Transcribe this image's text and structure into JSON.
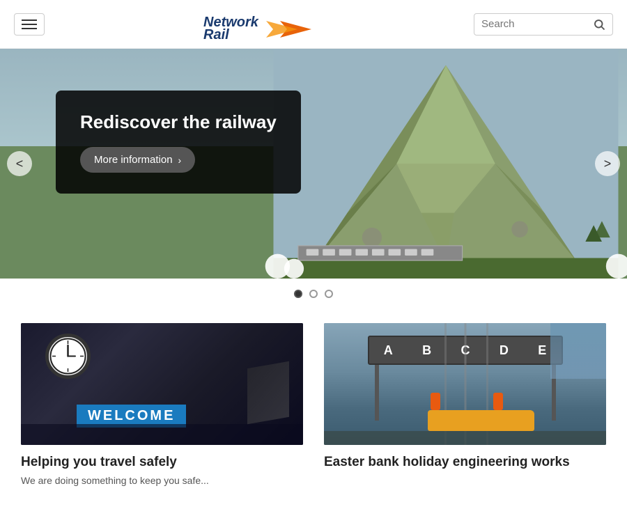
{
  "header": {
    "menu_label": "Menu",
    "logo_network": "Network",
    "logo_rail": "Rail",
    "search_placeholder": "Search",
    "search_button_label": "Search"
  },
  "hero": {
    "title": "Rediscover the railway",
    "more_info_label": "More information",
    "prev_label": "<",
    "next_label": ">"
  },
  "slider": {
    "dots": [
      {
        "active": true,
        "label": "Slide 1"
      },
      {
        "active": false,
        "label": "Slide 2"
      },
      {
        "active": false,
        "label": "Slide 3"
      }
    ]
  },
  "cards": [
    {
      "title": "Helping you travel safely",
      "description": "We are doing something...",
      "image_label": "Station welcome image"
    },
    {
      "title": "Easter bank holiday engineering works",
      "description": "",
      "image_label": "Railway engineering works image"
    }
  ]
}
